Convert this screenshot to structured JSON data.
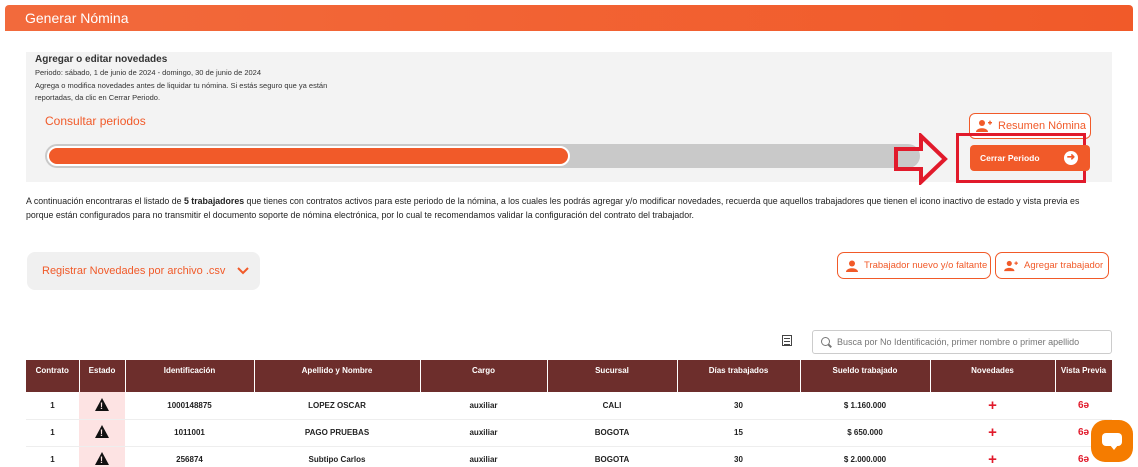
{
  "header": {
    "title": "Generar Nómina"
  },
  "panel": {
    "title": "Agregar o editar novedades",
    "period": "Periodo: sábado, 1 de junio de 2024 - domingo, 30 de junio de 2024",
    "hint": "Agrega o modifica novedades antes de liquidar tu nómina. Si estás seguro que ya están reportadas, da clic en Cerrar Periodo.",
    "consult_link": "Consultar periodos",
    "progress_fraction": 0.6
  },
  "buttons": {
    "resumen": "Resumen Nómina",
    "cerrar": "Cerrar Periodo",
    "csv": "Registrar Novedades por archivo .csv",
    "trabajador_nuevo": "Trabajador nuevo y/o faltante",
    "agregar_trabajador": "Agregar trabajador"
  },
  "intro": {
    "part1": "A continuación encontraras el listado de ",
    "bold": "5 trabajadores",
    "part2": " que tienes con contratos activos para este periodo de la nómina, a los cuales les podrás agregar y/o modificar novedades, recuerda que aquellos trabajadores que tienen el icono inactivo de estado y vista previa es porque están configurados para no transmitir el documento soporte de nómina electrónica, por lo cual te recomendamos validar la configuración del contrato del trabajador."
  },
  "search": {
    "placeholder": "Busca por No Identificación, primer nombre o primer apellido"
  },
  "table": {
    "columns": [
      "Contrato",
      "Estado",
      "Identificación",
      "Apellido y Nombre",
      "Cargo",
      "Sucursal",
      "Días trabajados",
      "Sueldo trabajado",
      "Novedades",
      "Vista Previa"
    ],
    "rows": [
      {
        "contrato": "1",
        "id": "1000148875",
        "nombre": "LOPEZ OSCAR",
        "cargo": "auxiliar",
        "sucursal": "CALI",
        "dias": "30",
        "sueldo": "$ 1.160.000"
      },
      {
        "contrato": "1",
        "id": "1011001",
        "nombre": "PAGO PRUEBAS",
        "cargo": "auxiliar",
        "sucursal": "BOGOTA",
        "dias": "15",
        "sueldo": "$ 650.000"
      },
      {
        "contrato": "1",
        "id": "256874",
        "nombre": "Subtipo Carlos",
        "cargo": "auxiliar",
        "sucursal": "BOGOTA",
        "dias": "30",
        "sueldo": "$ 2.000.000"
      }
    ]
  },
  "glyphs": {
    "plus": "+",
    "glasses": "6ə",
    "arrow": "➜"
  },
  "colors": {
    "brand": "#f15a29",
    "table_header": "#6d2e2c",
    "alert": "#e11a2b",
    "chat": "#f57c00"
  }
}
